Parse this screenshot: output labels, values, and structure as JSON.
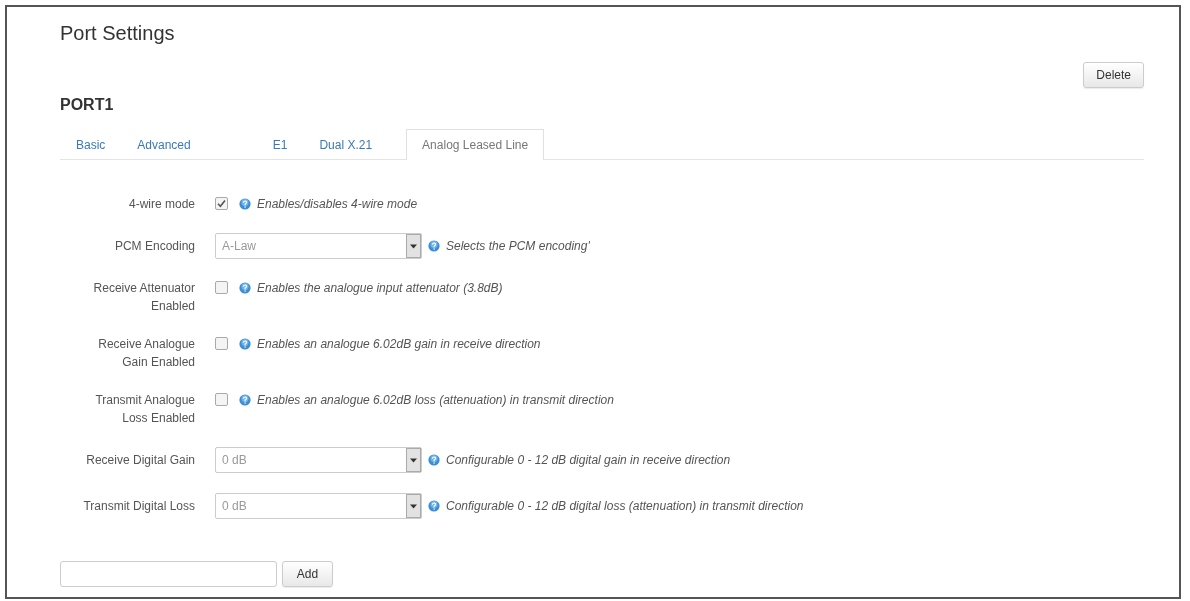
{
  "page": {
    "title": "Port Settings",
    "delete_button": "Delete"
  },
  "port": {
    "name": "PORT1",
    "tabs": [
      {
        "label": "Basic",
        "selected": false
      },
      {
        "label": "Advanced",
        "selected": false
      },
      {
        "label": "E1",
        "selected": false
      },
      {
        "label": "Dual X.21",
        "selected": false
      },
      {
        "label": "Analog Leased Line",
        "selected": true
      }
    ]
  },
  "fields": [
    {
      "kind": "checkbox",
      "label": "4-wire mode",
      "checked": true,
      "help": "Enables/disables 4-wire mode"
    },
    {
      "kind": "select",
      "label": "PCM Encoding",
      "value": "A-Law",
      "help": "Selects the PCM encoding'"
    },
    {
      "kind": "checkbox",
      "label": "Receive Attenuator Enabled",
      "checked": false,
      "help": "Enables the analogue input attenuator (3.8dB)"
    },
    {
      "kind": "checkbox",
      "label": "Receive Analogue Gain Enabled",
      "checked": false,
      "help": "Enables an analogue 6.02dB gain in receive direction"
    },
    {
      "kind": "checkbox",
      "label": "Transmit Analogue Loss Enabled",
      "checked": false,
      "help": "Enables an analogue 6.02dB loss (attenuation) in transmit direction"
    },
    {
      "kind": "select",
      "label": "Receive Digital Gain",
      "value": "0 dB",
      "help": "Configurable 0 - 12 dB digital gain in receive direction"
    },
    {
      "kind": "select",
      "label": "Transmit Digital Loss",
      "value": "0 dB",
      "help": "Configurable 0 - 12 dB digital loss (attenuation) in transmit direction"
    }
  ],
  "add_form": {
    "button": "Add"
  }
}
